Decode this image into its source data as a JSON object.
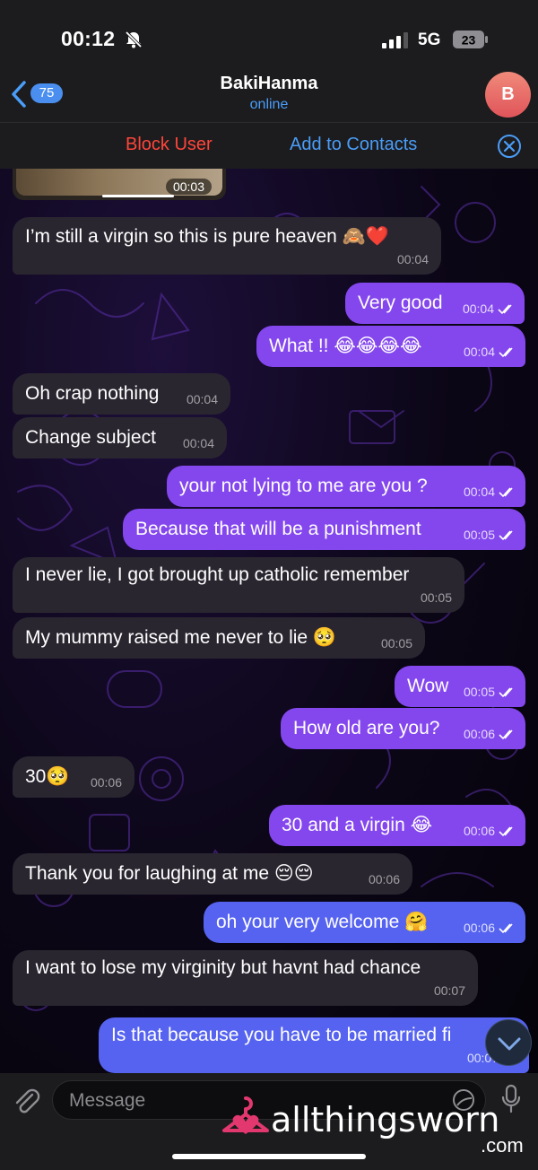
{
  "status": {
    "time": "00:12",
    "network": "5G",
    "battery": "23"
  },
  "nav": {
    "back_badge": "75",
    "title": "BakiHanma",
    "subtitle": "online",
    "avatar_letter": "B"
  },
  "actions": {
    "block": "Block User",
    "add": "Add to Contacts"
  },
  "media": {
    "duration": "00:03"
  },
  "messages": [
    {
      "dir": "in",
      "text": "I’m still a virgin so this is pure heaven 🙈❤️",
      "time": "00:04"
    },
    {
      "dir": "out",
      "text": "Very good",
      "time": "00:04"
    },
    {
      "dir": "out",
      "text": "What !! 😂😂😂😂",
      "time": "00:04"
    },
    {
      "dir": "in",
      "text": "Oh crap nothing",
      "time": "00:04"
    },
    {
      "dir": "in",
      "text": "Change subject",
      "time": "00:04"
    },
    {
      "dir": "out",
      "text": "your not lying to me are you ?",
      "time": "00:04"
    },
    {
      "dir": "out",
      "text": "Because that will be a punishment",
      "time": "00:05"
    },
    {
      "dir": "in",
      "text": "I never lie, I got brought up catholic remember",
      "time": "00:05"
    },
    {
      "dir": "in",
      "text": "My mummy raised me never to lie 🥺",
      "time": "00:05"
    },
    {
      "dir": "out",
      "text": "Wow",
      "time": "00:05"
    },
    {
      "dir": "out",
      "text": "How old are you?",
      "time": "00:06"
    },
    {
      "dir": "in",
      "text": "30🥺",
      "time": "00:06"
    },
    {
      "dir": "out",
      "text": "30 and a virgin 😂",
      "time": "00:06"
    },
    {
      "dir": "in",
      "text": "Thank you for laughing at me 😔😔",
      "time": "00:06"
    },
    {
      "dir": "out",
      "text": "oh your very welcome 🤗",
      "time": "00:06"
    },
    {
      "dir": "in",
      "text": "I want to lose my virginity but havnt had chance",
      "time": "00:07"
    },
    {
      "dir": "out",
      "text": "Is that because you have to be married fi",
      "time": "00:07"
    }
  ],
  "composer": {
    "placeholder": "Message"
  },
  "watermark": {
    "text": "allthingsworn",
    "suffix": ".com"
  },
  "colors": {
    "outgoing": "#8447ee",
    "outgoing_late": "#5663f0",
    "incoming": "#2a2630",
    "link": "#4a9df8",
    "danger": "#ff453a"
  },
  "icons": [
    "bell-slash-icon",
    "signal-icon",
    "battery-icon",
    "back-chevron-icon",
    "close-circle-icon",
    "read-checkmarks-icon",
    "chevron-down-icon",
    "paperclip-icon",
    "sticker-icon",
    "microphone-icon",
    "hanger-logo-icon"
  ]
}
